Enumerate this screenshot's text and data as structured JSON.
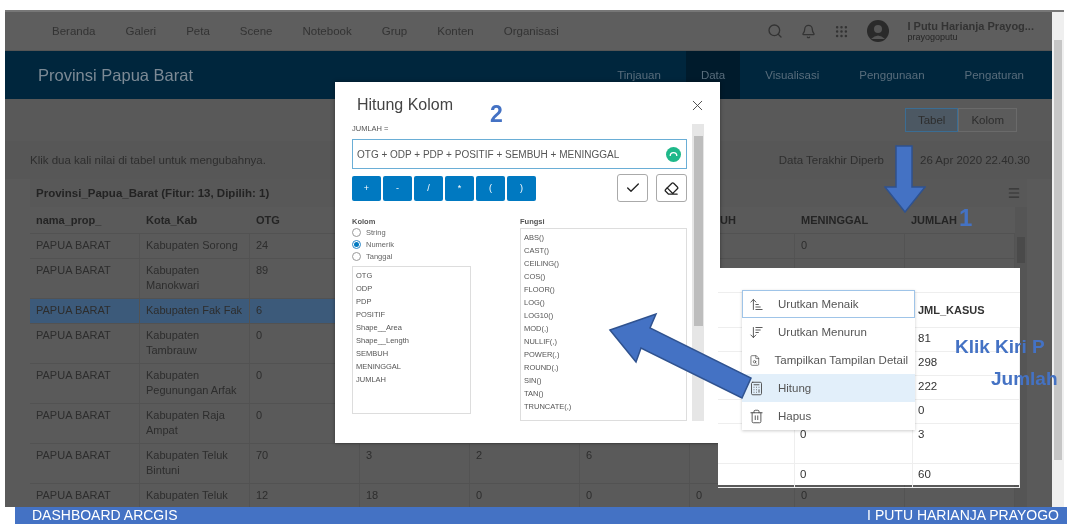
{
  "nav": {
    "links": [
      "Beranda",
      "Galeri",
      "Peta",
      "Scene",
      "Notebook",
      "Grup",
      "Konten",
      "Organisasi"
    ],
    "user": {
      "name": "I Putu Harianja Prayog...",
      "username": "prayogoputu"
    }
  },
  "header": {
    "title": "Provinsi Papua Barat",
    "tabs": [
      {
        "label": "Tinjauan",
        "selected": false
      },
      {
        "label": "Data",
        "selected": true
      },
      {
        "label": "Visualisasi",
        "selected": false
      },
      {
        "label": "Penggunaan",
        "selected": false
      },
      {
        "label": "Pengaturan",
        "selected": false
      }
    ]
  },
  "view_toggle": [
    {
      "label": "Tabel",
      "selected": true
    },
    {
      "label": "Kolom",
      "selected": false
    }
  ],
  "hint": "Klik dua kali nilai di tabel untuk mengubahnya.",
  "last_updated": {
    "label": "Data Terakhir Diperb",
    "value": "26 Apr 2020 22.40.30"
  },
  "table": {
    "title": "Provinsi_Papua_Barat (Fitur: 13, Dipilih: 1)",
    "columns": [
      "nama_prop_",
      "Kota_Kab",
      "OTG",
      null,
      null,
      null,
      "UH",
      "MENINGGAL",
      "JUMLAH"
    ],
    "rows": [
      {
        "selected": false,
        "cells": [
          "PAPUA BARAT",
          "Kabupaten Sorong",
          "24",
          null,
          null,
          null,
          null,
          "0",
          null
        ]
      },
      {
        "selected": false,
        "cells": [
          "PAPUA BARAT",
          "Kabupaten Manokwari",
          "89",
          null,
          null,
          null,
          null,
          null,
          null
        ]
      },
      {
        "selected": true,
        "cells": [
          "PAPUA BARAT",
          "Kabupaten Fak Fak",
          "6",
          null,
          null,
          null,
          null,
          null,
          null
        ]
      },
      {
        "selected": false,
        "cells": [
          "PAPUA BARAT",
          "Kabupaten Tambrauw",
          "0",
          null,
          null,
          null,
          null,
          null,
          null
        ]
      },
      {
        "selected": false,
        "cells": [
          "PAPUA BARAT",
          "Kabupaten Pegunungan Arfak",
          "0",
          null,
          null,
          null,
          null,
          null,
          null
        ]
      },
      {
        "selected": false,
        "cells": [
          "PAPUA BARAT",
          "Kabupaten Raja Ampat",
          "0",
          null,
          null,
          null,
          null,
          null,
          null
        ]
      },
      {
        "selected": false,
        "cells": [
          "PAPUA BARAT",
          "Kabupaten Teluk Bintuni",
          "70",
          "3",
          "2",
          "6",
          null,
          null,
          null
        ]
      },
      {
        "selected": false,
        "cells": [
          "PAPUA BARAT",
          "Kabupaten Teluk",
          "12",
          "18",
          "0",
          "0",
          "0",
          "0",
          null
        ]
      }
    ]
  },
  "calculate_dialog": {
    "title": "Hitung Kolom",
    "target": "JUMLAH =",
    "expression": "OTG + ODP + PDP + POSITIF + SEMBUH + MENINGGAL",
    "operators": [
      "+",
      "-",
      "/",
      "*",
      "(",
      ")"
    ],
    "columns_label": "Kolom",
    "types": [
      {
        "label": "String",
        "selected": false
      },
      {
        "label": "Numerik",
        "selected": true
      },
      {
        "label": "Tanggal",
        "selected": false
      }
    ],
    "columns": [
      "OTG",
      "ODP",
      "PDP",
      "POSITIF",
      "Shape__Area",
      "Shape__Length",
      "SEMBUH",
      "MENINGGAL",
      "JUMLAH"
    ],
    "functions_label": "Fungsi",
    "functions": [
      "ABS()",
      "CAST()",
      "CEILING()",
      "COS()",
      "FLOOR()",
      "LOG()",
      "LOG10()",
      "MOD(,)",
      "NULLIF(,)",
      "POWER(,)",
      "ROUND(,)",
      "SIN()",
      "TAN()",
      "TRUNCATE(,)"
    ]
  },
  "zoomed_table": {
    "header": "JML_KASUS",
    "rows": [
      {
        "jml_kasus": "81"
      },
      {
        "jml_kasus": "298"
      },
      {
        "jml_kasus": "222"
      },
      {
        "jml_kasus": "0"
      },
      {
        "column_2": "0",
        "jml_kasus": "3"
      },
      {
        "column_2": "0",
        "jml_kasus": "60"
      }
    ]
  },
  "context_menu": [
    {
      "label": "Urutkan Menaik",
      "focused": true,
      "selected": false
    },
    {
      "label": "Urutkan Menurun",
      "focused": false,
      "selected": false
    },
    {
      "label": "Tampilkan Tampilan Detail",
      "focused": false,
      "selected": false
    },
    {
      "label": "Hitung",
      "focused": false,
      "selected": true
    },
    {
      "label": "Hapus",
      "focused": false,
      "selected": false
    }
  ],
  "annotations": {
    "step_1": "1",
    "step_2": "2",
    "instruction": [
      "Klik Kiri P",
      "Jumlah"
    ]
  },
  "footer": {
    "left": "DASHBOARD ARCGIS",
    "right": "I PUTU HARIANJA PRAYOGO"
  }
}
